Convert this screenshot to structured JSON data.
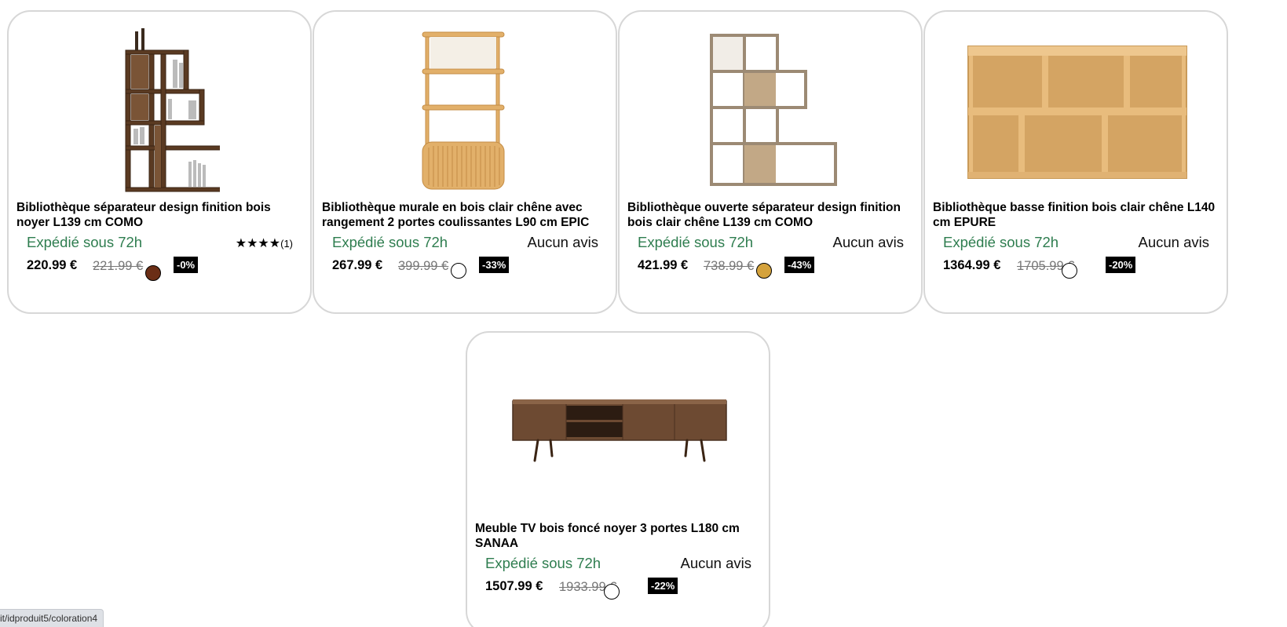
{
  "products": [
    {
      "title": "Bibliothèque séparateur design finition bois noyer L139 cm COMO",
      "shipping": "Expédié sous 72h",
      "reviews": "",
      "stars": "★★★★",
      "review_count": "(1)",
      "price": "220.99 €",
      "old_price": "221.99 €",
      "discount": "-0%",
      "swatch_color": "#6b2e16",
      "image_icon": "walnut-bookcase-image"
    },
    {
      "title": "Bibliothèque murale en bois clair chêne avec rangement 2 portes coulissantes L90 cm EPIC",
      "shipping": "Expédié sous 72h",
      "reviews": "Aucun avis",
      "price": "267.99 €",
      "old_price": "399.99 €",
      "discount": "-33%",
      "swatch_color": "#ffffff",
      "image_icon": "oak-wall-shelf-image"
    },
    {
      "title": "Bibliothèque ouverte séparateur design finition bois clair chêne L139 cm COMO",
      "shipping": "Expédié sous 72h",
      "reviews": "Aucun avis",
      "price": "421.99 €",
      "old_price": "738.99 €",
      "discount": "-43%",
      "swatch_color": "#d4a23c",
      "image_icon": "oak-bookcase-image"
    },
    {
      "title": "Bibliothèque basse finition bois clair chêne L140 cm EPURE",
      "shipping": "Expédié sous 72h",
      "reviews": "Aucun avis",
      "price": "1364.99 €",
      "old_price": "1705.99 €",
      "discount": "-20%",
      "swatch_color": "#ffffff",
      "image_icon": "low-bookcase-image"
    },
    {
      "title": "Meuble TV bois foncé noyer 3 portes L180 cm SANAA",
      "shipping": "Expédié sous 72h",
      "reviews": "Aucun avis",
      "price": "1507.99 €",
      "old_price": "1933.99 €",
      "discount": "-22%",
      "swatch_color": "#ffffff",
      "image_icon": "tv-stand-image"
    }
  ],
  "status_bar": {
    "url": "it/idproduit5/coloration4"
  },
  "colors": {
    "shipping_green": "#2e7d4f",
    "badge_black": "#000000",
    "card_border": "#d7d7d7"
  }
}
